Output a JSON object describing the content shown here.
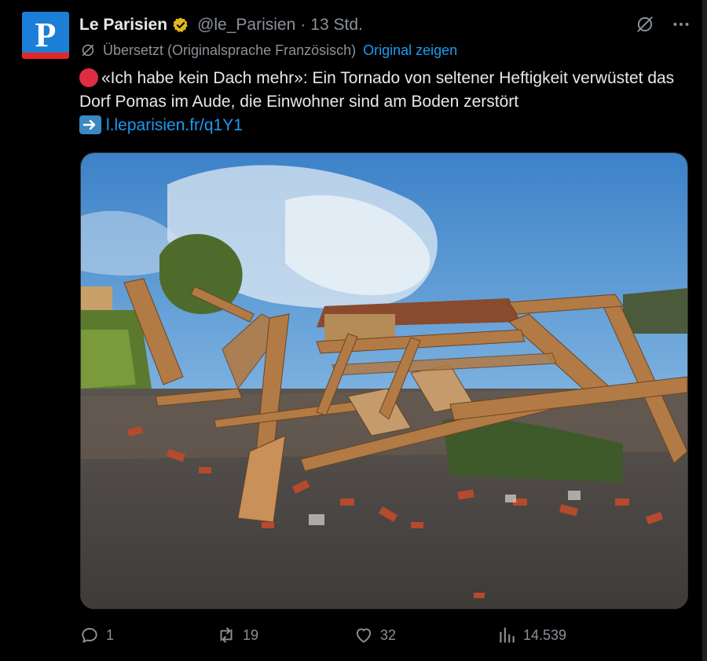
{
  "tweet": {
    "author_name": "Le Parisien",
    "avatar_letter": "P",
    "handle": "@le_Parisien",
    "separator": "·",
    "time": "13 Std.",
    "translated_label": "Übersetzt (Originalsprache Französisch)",
    "show_original": "Original zeigen",
    "text_line": "«Ich habe kein Dach mehr»: Ein Tornado von seltener Heftigkeit verwüstet das Dorf Pomas im Aude, die Einwohner sind am Boden zerstört",
    "link": "l.leparisien.fr/q1Y1"
  },
  "actions": {
    "replies": "1",
    "reposts": "19",
    "likes": "32",
    "views": "14.539"
  },
  "colors": {
    "background": "#000000",
    "text": "#e7e9ea",
    "muted": "#8b9198",
    "accent": "#1d9bf0",
    "avatar_blue": "#1b7fd8",
    "avatar_red": "#e3262b",
    "verified_gold": "#e2b719"
  },
  "icons": {
    "verified": "verified-badge-icon",
    "grok": "grok-icon",
    "more": "more-icon",
    "translate": "translate-icon",
    "reply": "reply-icon",
    "repost": "repost-icon",
    "like": "like-icon",
    "views": "views-icon",
    "bookmark": "bookmark-icon",
    "share": "share-icon"
  }
}
